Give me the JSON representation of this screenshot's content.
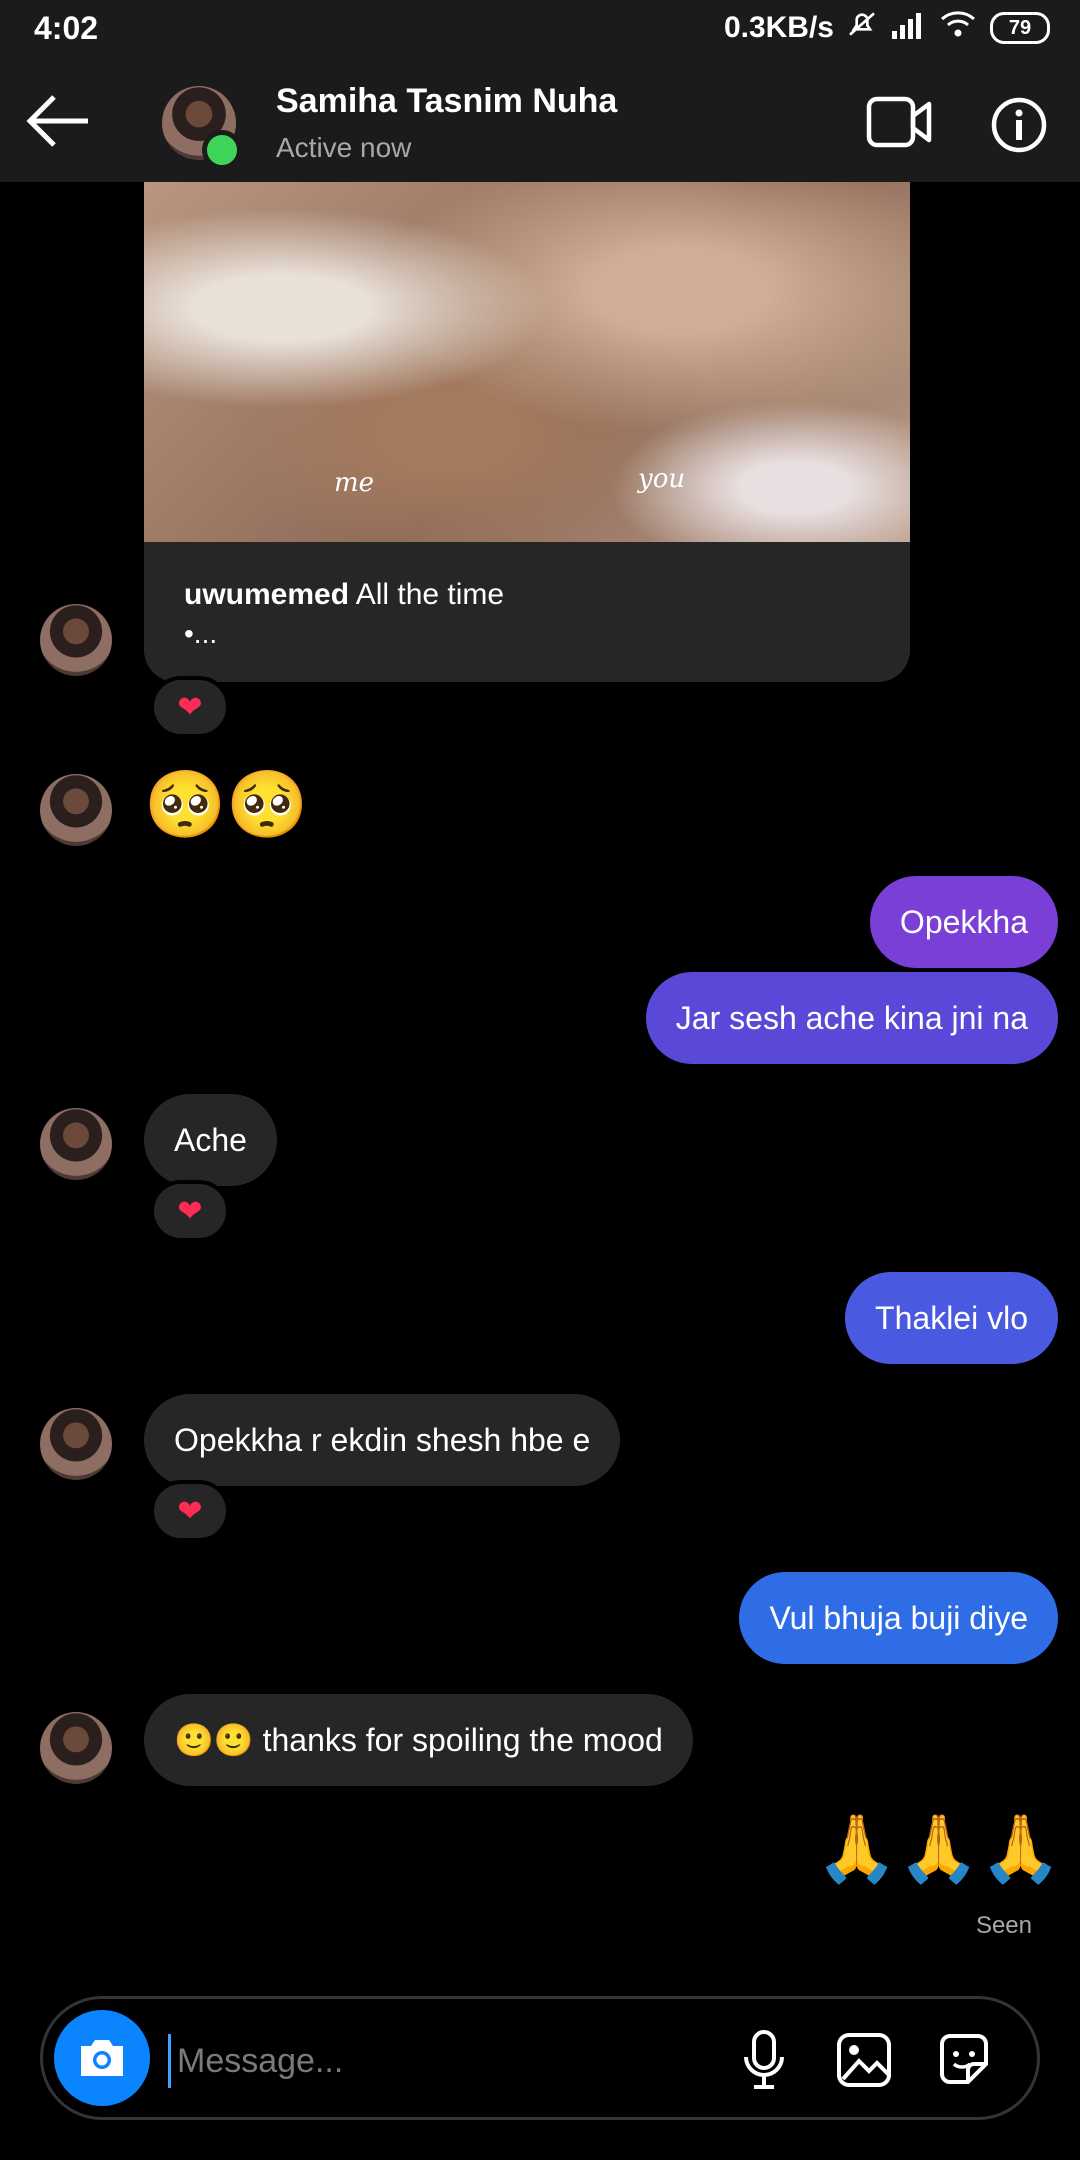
{
  "status_bar": {
    "time": "4:02",
    "net_speed": "0.3KB/s",
    "battery": "79"
  },
  "header": {
    "contact_name": "Samiha Tasnim Nuha",
    "contact_status": "Active now"
  },
  "shared_post": {
    "caption_left": "me",
    "caption_right": "you",
    "username": "uwumemed",
    "text": "All the time",
    "more": "•..."
  },
  "messages": {
    "m1_emoji": "🥺🥺",
    "m2": "Opekkha",
    "m3": "Jar sesh ache kina jni na",
    "m4": "Ache",
    "m5": "Thaklei vlo",
    "m6": "Opekkha r ekdin shesh hbe e",
    "m7": "Vul bhuja buji diye",
    "m8": "🙂🙂 thanks for spoiling the mood",
    "m9_emoji": "🙏🙏🙏",
    "reaction": "❤",
    "seen": "Seen"
  },
  "composer": {
    "placeholder": "Message..."
  },
  "colors": {
    "bubble_incoming": "#262626",
    "bubble_out_1": "#7a3fd6",
    "bubble_out_2": "#5a48d9",
    "bubble_out_3": "#4a5ae0",
    "bubble_out_4": "#2f6de6",
    "accent": "#0a84ff",
    "online": "#3fd55a"
  }
}
